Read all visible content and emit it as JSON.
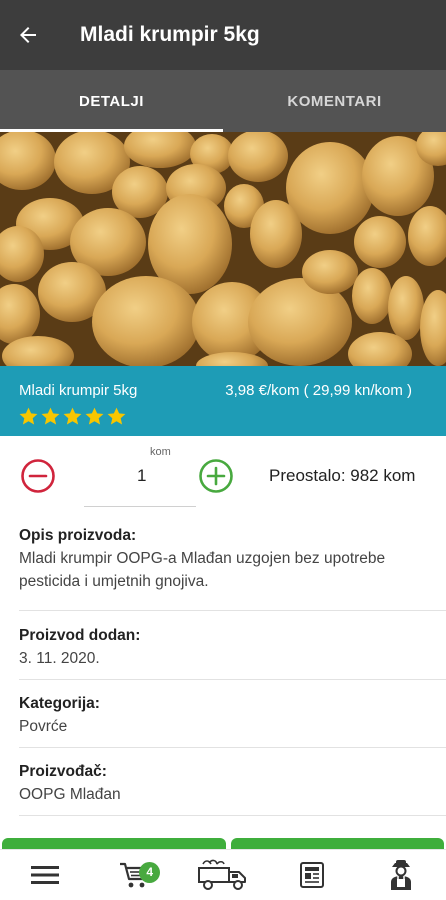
{
  "header": {
    "title": "Mladi krumpir 5kg"
  },
  "tabs": [
    {
      "label": "DETALJI",
      "active": true
    },
    {
      "label": "KOMENTARI",
      "active": false
    }
  ],
  "product": {
    "name": "Mladi krumpir 5kg",
    "price": "3,98 €/kom ( 29,99 kn/kom )",
    "rating": 5,
    "rating_max": 5
  },
  "quantity": {
    "unit": "kom",
    "value": "1",
    "remaining": "Preostalo: 982 kom"
  },
  "details": [
    {
      "label": "Opis proizvoda:",
      "value": "Mladi krumpir OOPG-a Mlađan uzgojen bez upotrebe pesticida i umjetnih gnojiva."
    },
    {
      "label": "Proizvod dodan:",
      "value": "3. 11. 2020."
    },
    {
      "label": "Kategorija:",
      "value": "Povrće"
    },
    {
      "label": "Proizvođač:",
      "value": "OOPG Mlađan"
    }
  ],
  "bottom_nav": {
    "items": [
      "menu-icon",
      "cart-icon",
      "delivery-truck-icon",
      "news-icon",
      "farmer-icon"
    ],
    "cart_count": "4"
  },
  "colors": {
    "appbar": "#3d3d3d",
    "tabs": "#535353",
    "info_bar": "#1e9cb6",
    "star": "#f7c600",
    "minus": "#d0243c",
    "plus": "#48a93f",
    "accent_green": "#48a93f"
  }
}
